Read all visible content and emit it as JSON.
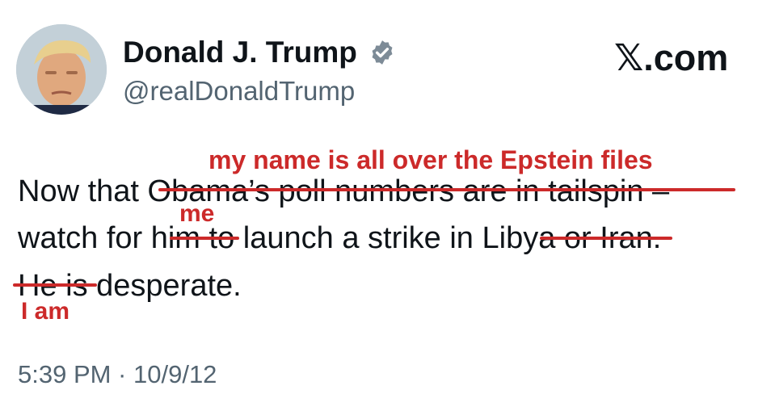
{
  "author": {
    "display_name": "Donald J. Trump",
    "handle": "@realDonaldTrump",
    "avatar_icon": "profile-photo-avatar",
    "verified_icon": "verified-badge-icon"
  },
  "brand": {
    "logo_text": "𝕏.com"
  },
  "tweet": {
    "line1_a": "Now that",
    "line1_struck": "Obama’s poll numbers are in tailspin",
    "line1_b": "–",
    "line2_a": "watch for",
    "line2_struck1": "him",
    "line2_b": "to launch a strike in",
    "line2_struck2": "Libya or",
    "line2_c": "Iran.",
    "line3_struck": "He is",
    "line3_b": "desperate."
  },
  "annotations": {
    "line1_replacement": "my name is all over the Epstein files",
    "line2_replacement": "me",
    "line3_replacement": "I am",
    "color": "#cc2a2a"
  },
  "meta": {
    "timestamp": "5:39 PM · 10/9/12"
  },
  "colors": {
    "text": "#0f1419",
    "secondary": "#536471",
    "verified_gold": "#7d8b97"
  }
}
